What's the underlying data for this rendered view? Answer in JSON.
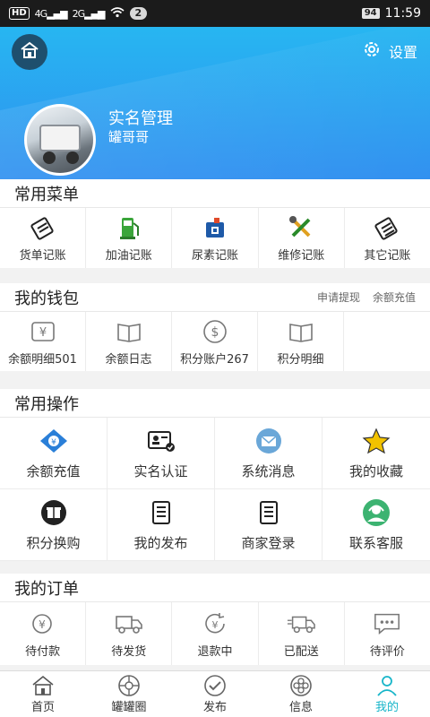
{
  "status": {
    "hd": "HD",
    "sig1": "4G",
    "sig2": "2G",
    "badge": "2",
    "battery": "94",
    "time": "11:59"
  },
  "header": {
    "settings_label": "设置",
    "title": "实名管理",
    "username": "罐哥哥"
  },
  "common_menu": {
    "title": "常用菜单",
    "items": [
      {
        "label": "货单记账",
        "icon": "waybill-icon"
      },
      {
        "label": "加油记账",
        "icon": "fuel-pump-icon"
      },
      {
        "label": "尿素记账",
        "icon": "urea-can-icon"
      },
      {
        "label": "维修记账",
        "icon": "repair-tools-icon"
      },
      {
        "label": "其它记账",
        "icon": "notebook-icon"
      }
    ]
  },
  "wallet": {
    "title": "我的钱包",
    "links": [
      "申请提现",
      "余额充值"
    ],
    "items": [
      {
        "label": "余额明细501",
        "icon": "yuan-ticket-icon"
      },
      {
        "label": "余额日志",
        "icon": "book-icon"
      },
      {
        "label": "积分账户267",
        "icon": "dollar-circle-icon"
      },
      {
        "label": "积分明细",
        "icon": "book-icon"
      }
    ]
  },
  "operations": {
    "title": "常用操作",
    "items": [
      {
        "label": "余额充值",
        "icon": "recharge-icon"
      },
      {
        "label": "实名认证",
        "icon": "id-card-icon"
      },
      {
        "label": "系统消息",
        "icon": "mail-icon"
      },
      {
        "label": "我的收藏",
        "icon": "star-icon"
      },
      {
        "label": "积分换购",
        "icon": "gift-icon"
      },
      {
        "label": "我的发布",
        "icon": "document-list-icon"
      },
      {
        "label": "商家登录",
        "icon": "document-list-icon"
      },
      {
        "label": "联系客服",
        "icon": "headset-icon"
      }
    ]
  },
  "orders": {
    "title": "我的订单",
    "items": [
      {
        "label": "待付款",
        "icon": "yuan-pay-icon"
      },
      {
        "label": "待发货",
        "icon": "truck-icon"
      },
      {
        "label": "退款中",
        "icon": "yuan-refund-icon"
      },
      {
        "label": "已配送",
        "icon": "delivery-truck-icon"
      },
      {
        "label": "待评价",
        "icon": "chat-bubble-icon"
      }
    ]
  },
  "nav": {
    "items": [
      {
        "label": "首页",
        "icon": "home-icon"
      },
      {
        "label": "罐罐圈",
        "icon": "aperture-icon"
      },
      {
        "label": "发布",
        "icon": "publish-check-icon"
      },
      {
        "label": "信息",
        "icon": "info-flower-icon"
      },
      {
        "label": "我的",
        "icon": "user-icon",
        "active": true
      }
    ]
  },
  "colors": {
    "accent": "#17b5c9",
    "header_top": "#27b6f1",
    "header_bottom": "#2f8ff0"
  }
}
